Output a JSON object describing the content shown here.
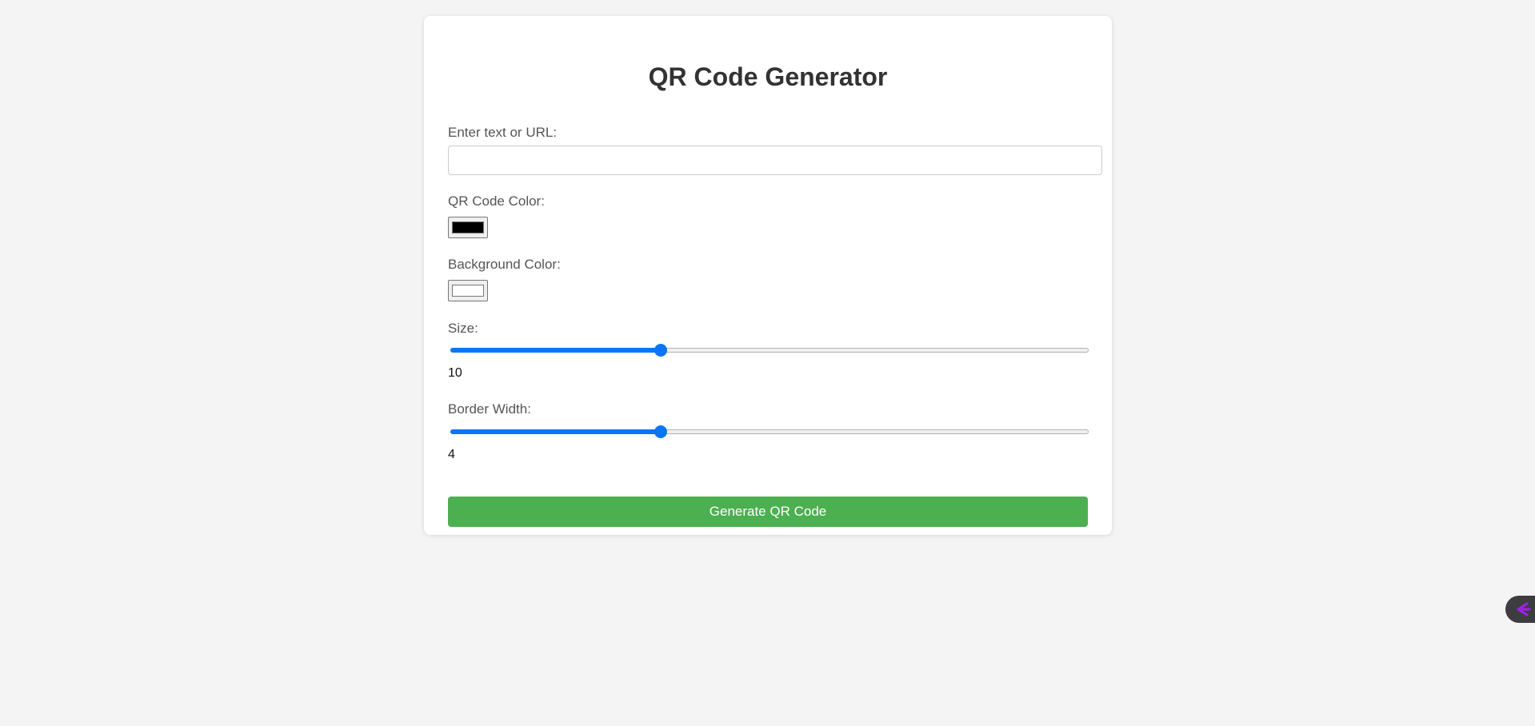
{
  "page": {
    "title": "QR Code Generator"
  },
  "form": {
    "text_label": "Enter text or URL:",
    "text_value": "",
    "text_placeholder": "",
    "qr_color_label": "QR Code Color:",
    "qr_color_value": "#000000",
    "bg_color_label": "Background Color:",
    "bg_color_value": "#ffffff",
    "size_label": "Size:",
    "size_value": "10",
    "size_fraction": 0.33,
    "border_label": "Border Width:",
    "border_value": "4",
    "border_fraction": 0.33,
    "generate_label": "Generate QR Code"
  },
  "colors": {
    "accent": "#0b75f5",
    "button": "#4caf50",
    "widget": "#3d3d3f",
    "widget_icon": "#a020f0"
  },
  "icons": {
    "floating_widget": "chevron-arrow-left-icon"
  }
}
